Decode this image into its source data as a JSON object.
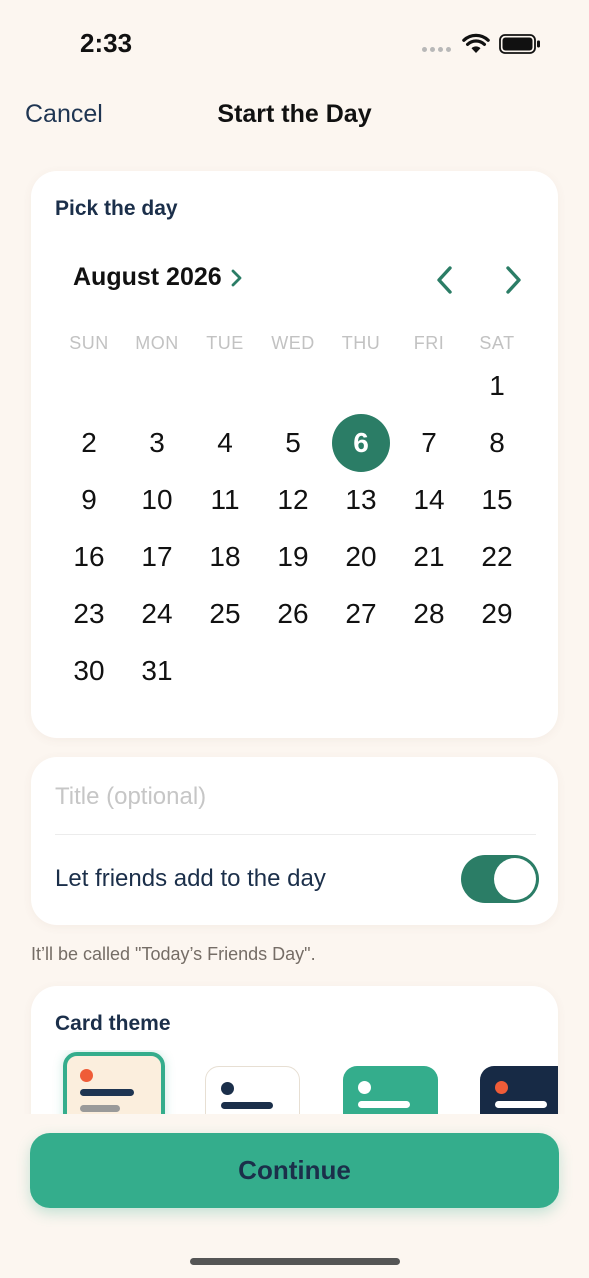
{
  "status_bar": {
    "time": "2:33"
  },
  "nav": {
    "cancel_label": "Cancel",
    "title": "Start the Day"
  },
  "calendar": {
    "heading": "Pick the day",
    "month_label": "August 2026",
    "weekdays": [
      "SUN",
      "MON",
      "TUE",
      "WED",
      "THU",
      "FRI",
      "SAT"
    ],
    "days": [
      "1",
      "2",
      "3",
      "4",
      "5",
      "6",
      "7",
      "8",
      "9",
      "10",
      "11",
      "12",
      "13",
      "14",
      "15",
      "16",
      "17",
      "18",
      "19",
      "20",
      "21",
      "22",
      "23",
      "24",
      "25",
      "26",
      "27",
      "28",
      "29",
      "30",
      "31"
    ],
    "selected_day": "6"
  },
  "details": {
    "title_placeholder": "Title (optional)",
    "title_value": "",
    "toggle_label": "Let friends add to the day",
    "toggle_on": true
  },
  "helper_text": "It’ll be called \"Today’s Friends Day\".",
  "theme": {
    "heading": "Card theme",
    "selected_index": 0
  },
  "footer": {
    "continue_label": "Continue"
  },
  "colors": {
    "accent": "#2b7d66",
    "button": "#34ad8c",
    "background": "#fcf6f0",
    "text_navy": "#1b2f4a"
  }
}
